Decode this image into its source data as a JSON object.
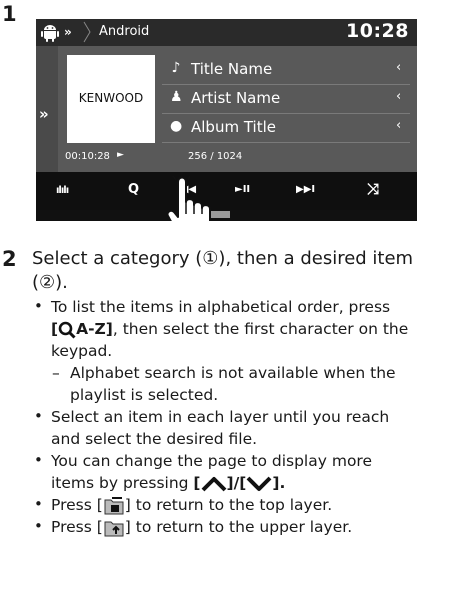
{
  "steps": {
    "one": "1",
    "two": "2"
  },
  "screen": {
    "breadcrumb": "»",
    "app_title": "Android",
    "clock": "10:28",
    "side_tab": "»",
    "album_art_text": "KENWOOD",
    "rows": [
      {
        "icon": "♪",
        "text": "Title Name",
        "chevron": "‹"
      },
      {
        "icon": "♟",
        "text": "Artist Name",
        "chevron": "‹"
      },
      {
        "icon": "●",
        "text": "Album Title",
        "chevron": "‹"
      }
    ],
    "elapsed": "00:10:28",
    "play_indicator": "►",
    "track_count": "256 / 1024",
    "controls": {
      "equalizer": "ılılı",
      "search": "Q",
      "previous": "I◀◀",
      "play_pause": "►II",
      "next": "▶▶I",
      "shuffle": "⤨"
    }
  },
  "text": {
    "step2_line1": "Select a category (①), then a desired item",
    "step2_line2": "(②).",
    "bullets": [
      {
        "pre": "To list the items in alphabetical order, press",
        "line2_key_open": "[",
        "line2_key_text": "A-Z]",
        "line2_rest": ", then select the first character on the",
        "line3": "keypad."
      },
      {
        "sub1": "Alphabet search is not available when the",
        "sub2": "playlist is selected."
      },
      {
        "l1": "Select an item in each layer until you reach",
        "l2": "and select the desired file."
      },
      {
        "l1": "You can change the page to display more",
        "l2_pre": "items by pressing ",
        "l2_open": "[",
        "l2_mid": "]/[",
        "l2_close": "]."
      },
      {
        "pre": "Press [",
        "post": "] to return to the top layer."
      },
      {
        "pre": "Press [",
        "post": "] to return to the upper layer."
      }
    ],
    "dash": "–",
    "bullet_char": "•"
  },
  "colors": {
    "screen_bg": "#595959",
    "top_bar": "#2a2a2a",
    "control_bar": "#0f0f0f"
  }
}
